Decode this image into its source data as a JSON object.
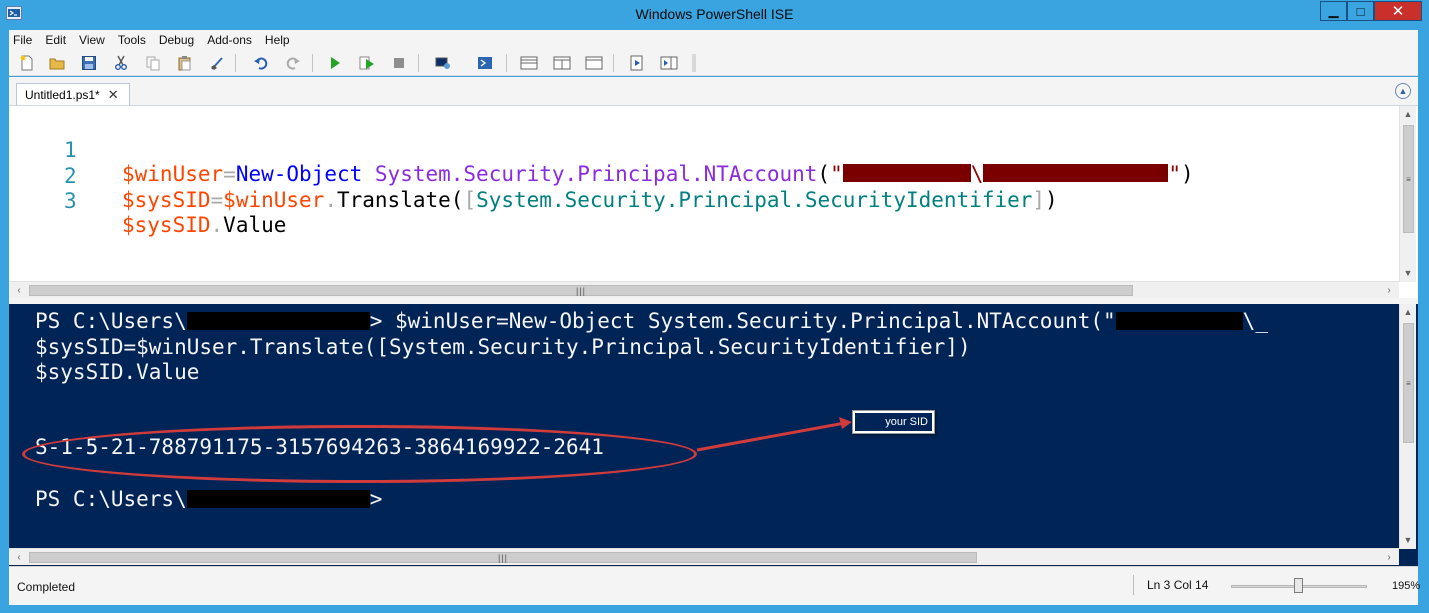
{
  "window": {
    "title": "Windows PowerShell ISE",
    "controls": {
      "minimize": "▁",
      "maximize": "□",
      "close": "✕"
    }
  },
  "menu": [
    "File",
    "Edit",
    "View",
    "Tools",
    "Debug",
    "Add-ons",
    "Help"
  ],
  "toolbar": {
    "icons": [
      "new-file-icon",
      "open-folder-icon",
      "save-icon",
      "cut-icon",
      "copy-icon",
      "paste-icon",
      "clear-console-icon",
      "undo-icon",
      "redo-icon",
      "run-script-icon",
      "run-selection-icon",
      "stop-icon",
      "new-remote-tab-icon",
      "start-powershell-icon",
      "show-script-top-icon",
      "show-script-right-icon",
      "show-script-maximized-icon",
      "show-command-window-icon",
      "show-command-addon-icon"
    ]
  },
  "tabs": [
    {
      "label": "Untitled1.ps1*",
      "close": "✕"
    }
  ],
  "script": {
    "lines": [
      {
        "number": "1",
        "tokens": [
          {
            "t": "var",
            "text": "$winUser"
          },
          {
            "t": "op",
            "text": "="
          },
          {
            "t": "cmd",
            "text": "New-Object"
          },
          {
            "t": "sp",
            "text": " "
          },
          {
            "t": "arg",
            "text": "System.Security.Principal.NTAccount"
          },
          {
            "t": "grp",
            "text": "("
          },
          {
            "t": "str",
            "text": "\""
          },
          {
            "t": "redact",
            "width": 128
          },
          {
            "t": "str",
            "text": "\\"
          },
          {
            "t": "redact",
            "width": 185
          },
          {
            "t": "str",
            "text": "\""
          },
          {
            "t": "grp",
            "text": ")"
          }
        ]
      },
      {
        "number": "2",
        "tokens": [
          {
            "t": "var",
            "text": "$sysSID"
          },
          {
            "t": "op",
            "text": "="
          },
          {
            "t": "var",
            "text": "$winUser"
          },
          {
            "t": "op",
            "text": "."
          },
          {
            "t": "member",
            "text": "Translate"
          },
          {
            "t": "grp",
            "text": "("
          },
          {
            "t": "op",
            "text": "["
          },
          {
            "t": "type",
            "text": "System.Security.Principal.SecurityIdentifier"
          },
          {
            "t": "op",
            "text": "]"
          },
          {
            "t": "grp",
            "text": ")"
          }
        ]
      },
      {
        "number": "3",
        "tokens": [
          {
            "t": "var",
            "text": "$sysSID"
          },
          {
            "t": "op",
            "text": "."
          },
          {
            "t": "member",
            "text": "Value"
          }
        ]
      }
    ]
  },
  "console": {
    "prompt_prefix": "PS C:\\Users\\",
    "line1_rest": "> $winUser=New-Object System.Security.Principal.NTAccount(\"",
    "line1_tail": "\\_",
    "line2": "$sysSID=$winUser.Translate([System.Security.Principal.SecurityIdentifier])",
    "line3": "$sysSID.Value",
    "sid_output": "S-1-5-21-788791175-3157694263-3864169922-2641",
    "prompt_end": ">"
  },
  "annotation": {
    "callout_text": "your SID",
    "color": "#d23b3b"
  },
  "status": {
    "text": "Completed",
    "position": "Ln 3  Col 14",
    "zoom_label": "195%",
    "zoom_fraction": 0.46
  },
  "colors": {
    "chrome_blue": "#3aa4e0",
    "console_bg": "#012456",
    "variable": "#ff4500",
    "command": "#0000ff",
    "argument": "#8a2be2",
    "type": "#008080",
    "line_number": "#2b91af"
  }
}
